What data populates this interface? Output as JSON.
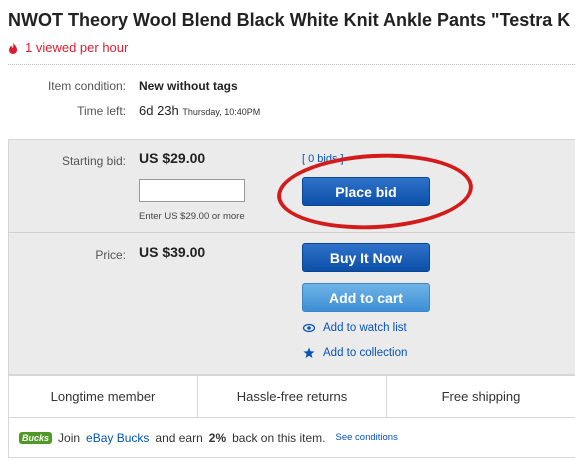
{
  "listing": {
    "title": "NWOT Theory Wool Blend Black White Knit Ankle Pants \"Testra K N",
    "views": "1 viewed per hour"
  },
  "details": {
    "condition_label": "Item condition:",
    "condition_value": "New without tags",
    "time_label": "Time left:",
    "time_value": "6d 23h",
    "time_detail": "Thursday, 10:40PM"
  },
  "bid": {
    "label": "Starting bid:",
    "amount": "US $29.00",
    "bids_link": "[ 0 bids ]",
    "input_placeholder": "",
    "enter_note": "Enter US $29.00 or more",
    "place_bid_label": "Place bid"
  },
  "buy": {
    "label": "Price:",
    "amount": "US $39.00",
    "buy_now_label": "Buy It Now",
    "add_to_cart_label": "Add to cart",
    "watch_label": "Add to watch list",
    "collection_label": "Add to collection"
  },
  "features": [
    "Longtime member",
    "Hassle-free returns",
    "Free shipping"
  ],
  "bucks": {
    "logo": "Bucks",
    "text_pre": "Join",
    "link": "eBay Bucks",
    "text_mid": "and earn",
    "percent": "2%",
    "text_post": "back on this item.",
    "see": "See conditions"
  },
  "colors": {
    "accent_red": "#dd1e31",
    "link_blue": "#0654ba",
    "button_dark": "#0b4fa8",
    "button_light": "#3c8fd6",
    "annotation_red": "#d41b1b",
    "bucks_green": "#4f9a26"
  },
  "icons": {
    "views": "flame-icon",
    "watch": "eye-icon",
    "collection": "star-icon"
  }
}
